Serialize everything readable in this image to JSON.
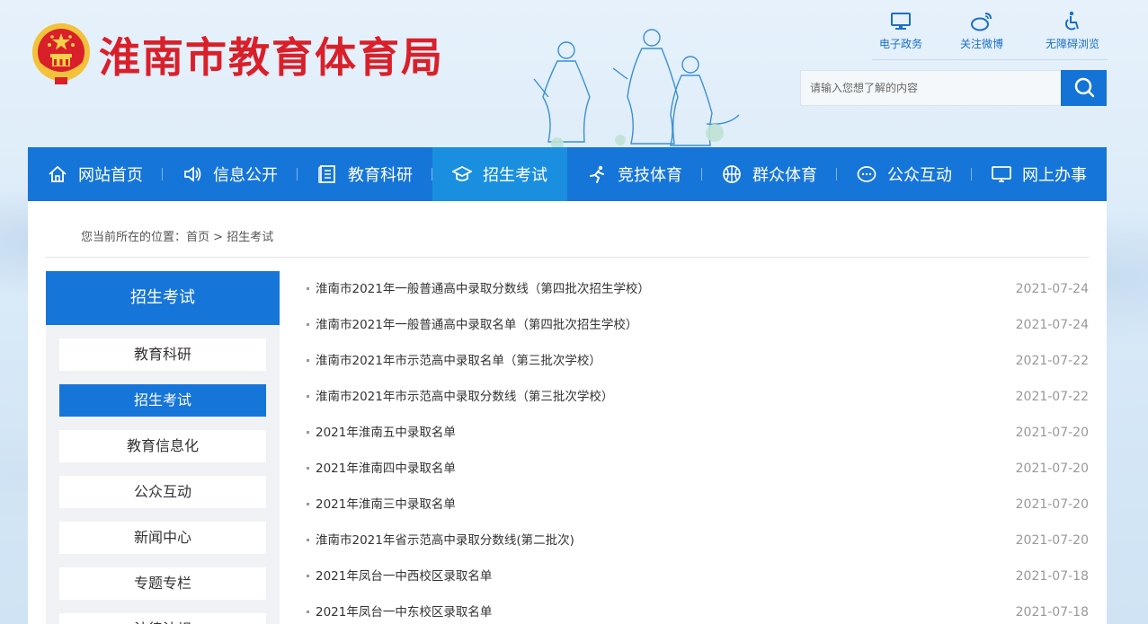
{
  "header": {
    "site_title": "淮南市教育体育局",
    "quick_links": [
      {
        "label": "电子政务",
        "icon": "monitor-icon"
      },
      {
        "label": "关注微博",
        "icon": "weibo-icon"
      },
      {
        "label": "无障碍浏览",
        "icon": "accessibility-icon"
      }
    ],
    "search": {
      "placeholder": "请输入您想了解的内容",
      "icon": "search-icon"
    }
  },
  "nav": {
    "items": [
      {
        "label": "网站首页",
        "icon": "home-icon"
      },
      {
        "label": "信息公开",
        "icon": "speaker-icon"
      },
      {
        "label": "教育科研",
        "icon": "book-icon"
      },
      {
        "label": "招生考试",
        "icon": "graduation-cap-icon",
        "active": true
      },
      {
        "label": "竞技体育",
        "icon": "runner-icon"
      },
      {
        "label": "群众体育",
        "icon": "basketball-icon"
      },
      {
        "label": "公众互动",
        "icon": "chat-icon"
      },
      {
        "label": "网上办事",
        "icon": "computer-icon"
      }
    ]
  },
  "breadcrumb": {
    "prefix": "您当前所在的位置：",
    "home": "首页",
    "separator": " > ",
    "current": "招生考试"
  },
  "sidebar": {
    "title": "招生考试",
    "items": [
      {
        "label": "教育科研"
      },
      {
        "label": "招生考试",
        "active": true
      },
      {
        "label": "教育信息化"
      },
      {
        "label": "公众互动"
      },
      {
        "label": "新闻中心"
      },
      {
        "label": "专题专栏"
      },
      {
        "label": "法律法规"
      }
    ]
  },
  "news": [
    {
      "title": "淮南市2021年一般普通高中录取分数线（第四批次招生学校）",
      "date": "2021-07-24"
    },
    {
      "title": "淮南市2021年一般普通高中录取名单（第四批次招生学校）",
      "date": "2021-07-24"
    },
    {
      "title": "淮南市2021年市示范高中录取名单（第三批次学校）",
      "date": "2021-07-22"
    },
    {
      "title": "淮南市2021年市示范高中录取分数线（第三批次学校）",
      "date": "2021-07-22"
    },
    {
      "title": "2021年淮南五中录取名单",
      "date": "2021-07-20"
    },
    {
      "title": "2021年淮南四中录取名单",
      "date": "2021-07-20"
    },
    {
      "title": "2021年淮南三中录取名单",
      "date": "2021-07-20"
    },
    {
      "title": "淮南市2021年省示范高中录取分数线(第二批次)",
      "date": "2021-07-20"
    },
    {
      "title": "2021年凤台一中西校区录取名单",
      "date": "2021-07-18"
    },
    {
      "title": "2021年凤台一中东校区录取名单",
      "date": "2021-07-18"
    }
  ],
  "colors": {
    "brand_blue": "#1675d8",
    "active_blue": "#1a8fe0",
    "title_red": "#d9202a",
    "emblem_gold": "#f2c23a"
  }
}
